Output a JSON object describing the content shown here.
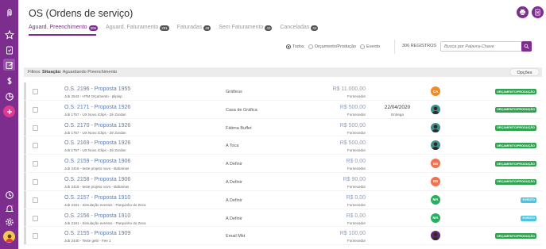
{
  "app": {
    "page_title": "OS (Ordens de serviço)"
  },
  "sidebar": {
    "items": [
      {
        "name": "logo-icon"
      },
      {
        "name": "star-icon"
      },
      {
        "name": "clipboard-icon"
      },
      {
        "name": "edit-icon"
      },
      {
        "name": "dollar-icon"
      },
      {
        "name": "chart-icon"
      },
      {
        "name": "plus-icon"
      },
      {
        "name": "clock-icon"
      },
      {
        "name": "bell-icon"
      },
      {
        "name": "gear-icon"
      },
      {
        "name": "avatar-icon"
      }
    ]
  },
  "header_buttons": [
    {
      "name": "print-icon"
    },
    {
      "name": "export-icon"
    }
  ],
  "tabs": [
    {
      "label": "Aguard. Preenchimento",
      "count": "306",
      "active": true
    },
    {
      "label": "Aguard. Faturamento",
      "count": "291",
      "active": false
    },
    {
      "label": "Faturadas",
      "count": "48",
      "active": false
    },
    {
      "label": "Sem Faturamento",
      "count": "40",
      "active": false
    },
    {
      "label": "Canceladas",
      "count": "34",
      "active": false
    }
  ],
  "filters": {
    "radios": [
      {
        "label": "Todos",
        "checked": true
      },
      {
        "label": "Orçamento/Produção",
        "checked": false
      },
      {
        "label": "Evento",
        "checked": false
      }
    ],
    "records": "306 REGISTROS",
    "search_placeholder": "Busca por Palavra-Chave"
  },
  "filter_summary": {
    "prefix": "Filtros: ",
    "key": "Situação",
    "value": ": Aguardando Preenchimento",
    "options_label": "Opções"
  },
  "colors": {
    "brand": "#7c2d8e",
    "badge_green": "#2ea44f",
    "badge_blue": "#4fc3dc"
  },
  "rows": [
    {
      "title": "O.S. 2196 - Proposta 1955",
      "sub": "Job 2543 - HTM Orçamento - pliplop",
      "client": "Gráfieus",
      "price": "R$ 11.000,00",
      "price_label": "Fornecedor",
      "date": "",
      "date_label": "",
      "avatar": "CA",
      "avatar_color": "#f08a24",
      "badge": "ORÇAMENTO/PRODUÇÃO",
      "badge_color": "#2ea44f"
    },
    {
      "title": "O.S. 2171 - Proposta 1926",
      "sub": "Job 1757 - UX Novo iClips - Zé Zordan",
      "client": "Casa de Gráfica",
      "price": "R$ 500,00",
      "price_label": "Fornecedor",
      "date": "22/04/2020",
      "date_label": "Entrega",
      "avatar": "",
      "avatar_color": "#3a8f8f",
      "badge": "ORÇAMENTO/PRODUÇÃO",
      "badge_color": "#2ea44f"
    },
    {
      "title": "O.S. 2170 - Proposta 1926",
      "sub": "Job 1757 - UX Novo iClips - Zé Zordan",
      "client": "Fátima Buffet",
      "price": "R$ 500,00",
      "price_label": "Fornecedor",
      "date": "",
      "date_label": "",
      "avatar": "",
      "avatar_color": "#3a8f8f",
      "badge": "ORÇAMENTO/PRODUÇÃO",
      "badge_color": "#2ea44f"
    },
    {
      "title": "O.S. 2169 - Proposta 1926",
      "sub": "Job 1757 - UX Novo iClips - Zé Zordan",
      "client": "A Toca",
      "price": "R$ 500,00",
      "price_label": "Fornecedor",
      "date": "",
      "date_label": "",
      "avatar": "",
      "avatar_color": "#3a8f8f",
      "badge": "ORÇAMENTO/PRODUÇÃO",
      "badge_color": "#2ea44f"
    },
    {
      "title": "O.S. 2159 - Proposta 1906",
      "sub": "Job 2416 - teste projeto novo - Bahamas",
      "client": "A Definir",
      "price": "R$ 0,00",
      "price_label": "Fornecedor",
      "date": "",
      "date_label": "",
      "avatar": "ED",
      "avatar_color": "#f2714e",
      "badge": "ORÇAMENTO/PRODUÇÃO",
      "badge_color": "#2ea44f"
    },
    {
      "title": "O.S. 2158 - Proposta 1906",
      "sub": "Job 2416 - teste projeto novo - Bahamas",
      "client": "A Definir",
      "price": "R$ 90,00",
      "price_label": "Fornecedor",
      "date": "",
      "date_label": "",
      "avatar": "ED",
      "avatar_color": "#f2714e",
      "badge": "ORÇAMENTO/PRODUÇÃO",
      "badge_color": "#2ea44f"
    },
    {
      "title": "O.S. 2157 - Proposta 1910",
      "sub": "Job 2181 - Simulação eventos - Parquinho do Zeca",
      "client": "A Definir",
      "price": "R$ 0,00",
      "price_label": "Fornecedor",
      "date": "",
      "date_label": "",
      "avatar": "MA",
      "avatar_color": "#27ae60",
      "badge": "EVENTO",
      "badge_color": "#4fc3dc"
    },
    {
      "title": "O.S. 2156 - Proposta 1910",
      "sub": "Job 2181 - Simulação eventos - Parquinho do Zeca",
      "client": "A Definir",
      "price": "R$ 0,00",
      "price_label": "Fornecedor",
      "date": "",
      "date_label": "",
      "avatar": "MA",
      "avatar_color": "#27ae60",
      "badge": "EVENTO",
      "badge_color": "#4fc3dc"
    },
    {
      "title": "O.S. 2155 - Proposta 1909",
      "sub": "Job 2440 - Teste gebi - Fee 1",
      "client": "Email Mkt",
      "price": "R$ 100,00",
      "price_label": "Fornecedor",
      "date": "",
      "date_label": "",
      "avatar": "",
      "avatar_color": "#5b2a6e",
      "badge": "ORÇAMENTO/PRODUÇÃO",
      "badge_color": "#2ea44f"
    }
  ]
}
